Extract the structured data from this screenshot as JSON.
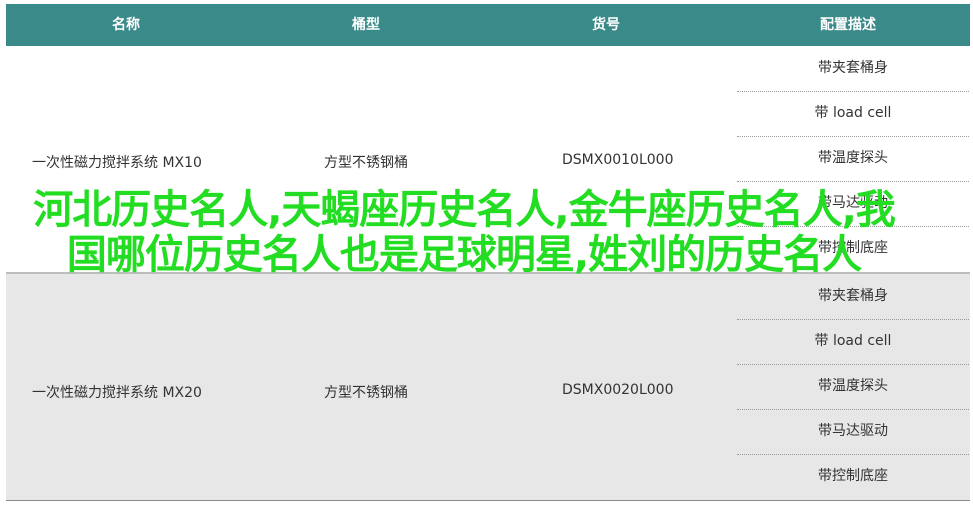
{
  "table": {
    "headers": {
      "name": "名称",
      "barrel": "桶型",
      "sku": "货号",
      "config": "配置描述"
    },
    "rows": [
      {
        "name": "一次性磁力搅拌系统 MX10",
        "barrel": "方型不锈钢桶",
        "sku": "DSMX0010L000",
        "configs": [
          "带夹套桶身",
          "带 load cell",
          "带温度探头",
          "带马达驱动",
          "带控制底座"
        ]
      },
      {
        "name": "一次性磁力搅拌系统 MX20",
        "barrel": "方型不锈钢桶",
        "sku": "DSMX0020L000",
        "configs": [
          "带夹套桶身",
          "带 load cell",
          "带温度探头",
          "带马达驱动",
          "带控制底座"
        ]
      }
    ]
  },
  "overlay": {
    "title": "河北历史名人,天蝎座历史名人,金牛座历史名人,我国哪位历史名人也是足球明星,姓刘的历史名人"
  },
  "colors": {
    "header_bg": "#3a8a8a",
    "overlay_text": "#22dd22",
    "row_alt_bg": "#e7e7e7"
  }
}
